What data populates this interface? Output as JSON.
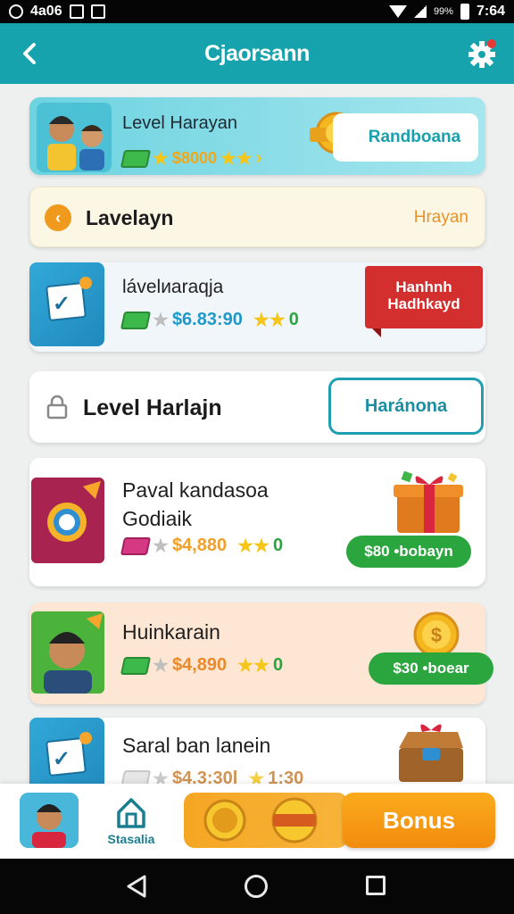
{
  "status_bar": {
    "left_text": "4a06",
    "battery_pct": "99%",
    "time": "7:64"
  },
  "header": {
    "title": "Cjaorsann",
    "back_icon": "chevron-left-icon",
    "settings_icon": "gear-icon"
  },
  "cards": [
    {
      "title": "Level Harayan",
      "reward": "$8000",
      "button": "Randboana",
      "style": "banner"
    },
    {
      "title": "Lavelayn",
      "right_text": "Hrayan",
      "icon": "arrow-left-circle-icon"
    },
    {
      "title": "lávelиaraqja",
      "reward": "$6.83:90",
      "rating": "0",
      "ribbon": [
        "Hanhnh",
        "Hadhkayd"
      ]
    },
    {
      "title": "Level Harlajn",
      "button": "Haránona",
      "icon": "lock-icon"
    },
    {
      "title_lines": [
        "Paval kandasoa",
        "Godiaik"
      ],
      "reward": "$4,880",
      "rating": "0",
      "button": "$80 •bobayn",
      "icon": "target-icon"
    },
    {
      "title": "Huinkarain",
      "reward": "$4,890",
      "rating": "0",
      "button": "$30 •boear",
      "icon": "person-icon"
    },
    {
      "title": "Saral ban lanein",
      "reward": "$4.3:30l",
      "rating": "1:30",
      "icon": "document-check-icon"
    }
  ],
  "bottom_bar": {
    "home_label": "Stasalia",
    "bonus_label": "Bonus"
  },
  "colors": {
    "teal": "#16a3ad",
    "orange": "#f59e1a",
    "green": "#2ba53e",
    "red": "#d32f2f"
  }
}
